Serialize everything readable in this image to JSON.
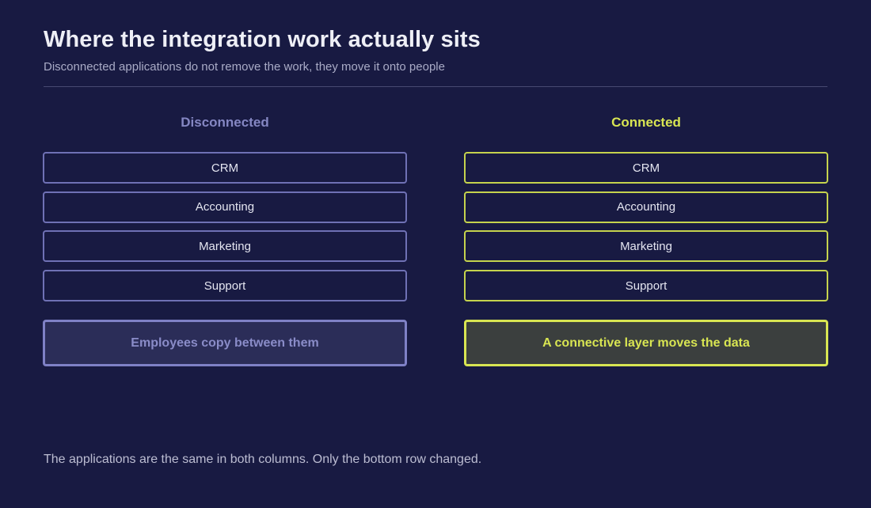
{
  "header": {
    "title": "Where the integration work actually sits",
    "subtitle": "Disconnected applications do not remove the work, they move it onto people"
  },
  "columns": {
    "left": {
      "heading": "Disconnected",
      "apps": [
        "CRM",
        "Accounting",
        "Marketing",
        "Support"
      ],
      "bottom": "Employees copy between them"
    },
    "right": {
      "heading": "Connected",
      "apps": [
        "CRM",
        "Accounting",
        "Marketing",
        "Support"
      ],
      "bottom": "A connective layer moves the data"
    }
  },
  "footnote": "The applications are the same in both columns. Only the bottom row changed.",
  "colors": {
    "background": "#181a42",
    "disconnected_accent": "#7f81c6",
    "connected_accent": "#d8e552"
  }
}
